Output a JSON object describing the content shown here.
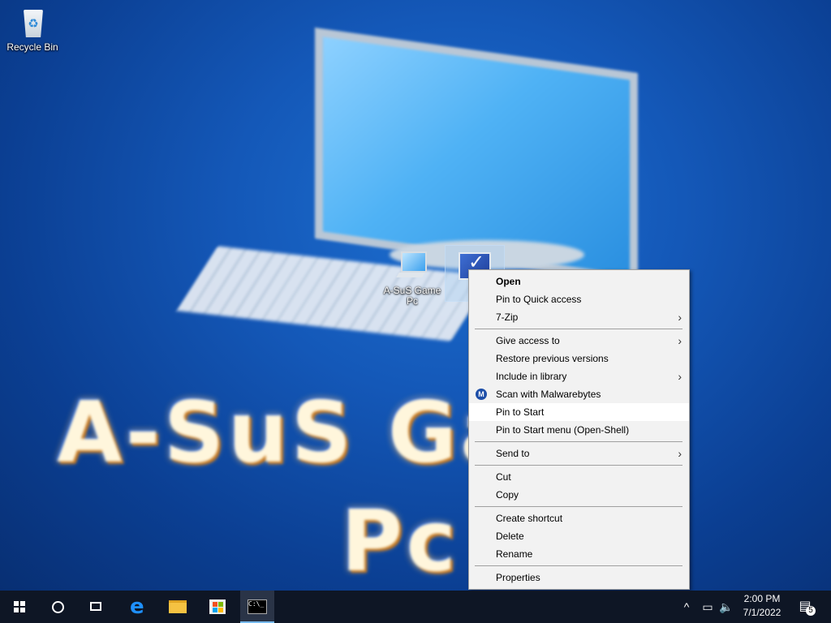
{
  "desktop": {
    "wallpaper_text_line1": "A-SuS Game",
    "wallpaper_text_line2": "Pc",
    "icons": [
      {
        "label": "Recycle Bin",
        "icon": "recycle-bin-icon"
      },
      {
        "label": "A-SuS Game Pc",
        "icon": "computer-icon"
      },
      {
        "label": "",
        "icon": "checked-file-icon"
      }
    ]
  },
  "context_menu": {
    "items": [
      {
        "label": "Open",
        "bold": true
      },
      {
        "label": "Pin to Quick access"
      },
      {
        "label": "7-Zip",
        "submenu": true
      },
      {
        "separator": true
      },
      {
        "label": "Give access to",
        "submenu": true
      },
      {
        "label": "Restore previous versions"
      },
      {
        "label": "Include in library",
        "submenu": true
      },
      {
        "label": "Scan with Malwarebytes",
        "icon": "malwarebytes-icon"
      },
      {
        "label": "Pin to Start",
        "highlighted": true
      },
      {
        "label": "Pin to Start menu (Open-Shell)"
      },
      {
        "separator": true
      },
      {
        "label": "Send to",
        "submenu": true
      },
      {
        "separator": true
      },
      {
        "label": "Cut"
      },
      {
        "label": "Copy"
      },
      {
        "separator": true
      },
      {
        "label": "Create shortcut"
      },
      {
        "label": "Delete"
      },
      {
        "label": "Rename"
      },
      {
        "separator": true
      },
      {
        "label": "Properties"
      }
    ],
    "submenu_arrow": "›"
  },
  "taskbar": {
    "buttons": [
      "start-icon",
      "search-icon",
      "task-view-icon",
      "edge-icon",
      "file-explorer-icon",
      "store-icon",
      "command-prompt-icon"
    ],
    "tray": {
      "chevron": "^",
      "network_icon": "network-icon",
      "volume_icon": "volume-icon",
      "time": "2:00 PM",
      "date": "7/1/2022",
      "notification_count": "5"
    }
  },
  "colors": {
    "taskbar_bg": "#0e1625",
    "menu_bg": "#f2f2f2",
    "menu_highlight": "#ffffff",
    "accent": "#76b9ed"
  }
}
